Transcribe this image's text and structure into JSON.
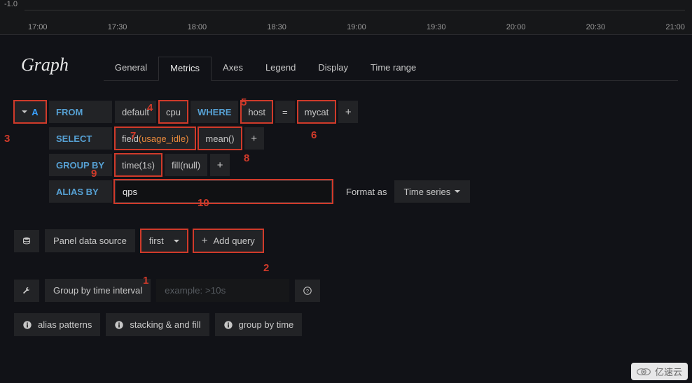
{
  "chart": {
    "y_tick": "-1.0",
    "x_ticks": [
      "17:00",
      "17:30",
      "18:00",
      "18:30",
      "19:00",
      "19:30",
      "20:00",
      "20:30",
      "21:00"
    ]
  },
  "title": "Graph",
  "tabs": {
    "general": "General",
    "metrics": "Metrics",
    "axes": "Axes",
    "legend": "Legend",
    "display": "Display",
    "time_range": "Time range"
  },
  "query": {
    "letter": "A",
    "from_kw": "FROM",
    "from_policy": "default",
    "from_measurement": "cpu",
    "where_kw": "WHERE",
    "where_tag": "host",
    "where_op": "=",
    "where_val": "mycat",
    "select_kw": "SELECT",
    "select_field_prefix": "field",
    "select_field_name": "(usage_idle)",
    "select_func": "mean()",
    "groupby_kw": "GROUP BY",
    "groupby_time": "time(1s)",
    "groupby_fill": "fill(null)",
    "aliasby_kw": "ALIAS BY",
    "alias_value": "qps",
    "plus": "+",
    "format_label": "Format as",
    "format_value": "Time series"
  },
  "panel_ds": {
    "label": "Panel data source",
    "value": "first",
    "add_query": "Add query"
  },
  "groupby_interval": {
    "label": "Group by time interval",
    "placeholder": "example: >10s",
    "help": "?"
  },
  "help_buttons": {
    "alias_patterns": "alias patterns",
    "stacking": "stacking & and fill",
    "groupby": "group by time"
  },
  "callouts": {
    "c1": "1",
    "c2": "2",
    "c3": "3",
    "c4": "4",
    "c5": "5",
    "c6": "6",
    "c7": "7",
    "c8": "8",
    "c9": "9",
    "c10": "10"
  },
  "watermark": "亿速云"
}
